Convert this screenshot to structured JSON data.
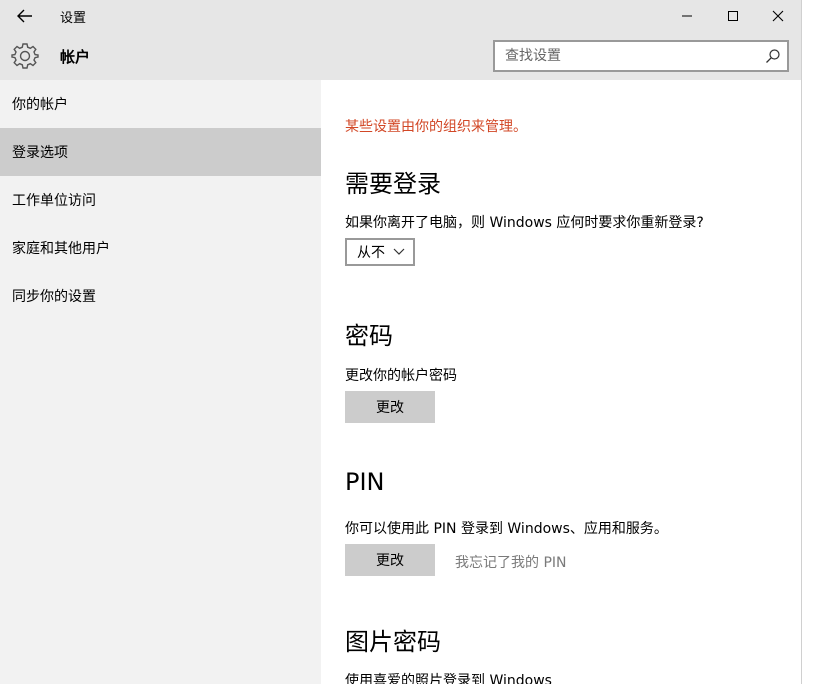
{
  "window": {
    "title": "设置",
    "back_icon": "arrow-left-icon",
    "minimize_icon": "minimize-icon",
    "maximize_icon": "maximize-icon",
    "close_icon": "close-icon"
  },
  "header": {
    "icon": "gear-icon",
    "title": "帐户",
    "search_placeholder": "查找设置",
    "search_value": "",
    "search_icon": "search-icon"
  },
  "sidebar": {
    "items": [
      {
        "label": "你的帐户",
        "selected": false
      },
      {
        "label": "登录选项",
        "selected": true
      },
      {
        "label": "工作单位访问",
        "selected": false
      },
      {
        "label": "家庭和其他用户",
        "selected": false
      },
      {
        "label": "同步你的设置",
        "selected": false
      }
    ]
  },
  "content": {
    "managed_note": "某些设置由你的组织来管理。",
    "require_signin": {
      "title": "需要登录",
      "description": "如果你离开了电脑，则 Windows 应何时要求你重新登录?",
      "dropdown_value": "从不"
    },
    "password": {
      "title": "密码",
      "description": "更改你的帐户密码",
      "button_label": "更改"
    },
    "pin": {
      "title": "PIN",
      "description": "你可以使用此 PIN 登录到 Windows、应用和服务。",
      "button_label": "更改",
      "forgot_link": "我忘记了我的 PIN"
    },
    "picture_password": {
      "title": "图片密码",
      "description": "使用喜爱的照片登录到 Windows"
    }
  },
  "colors": {
    "titlebar_bg": "#e6e6e6",
    "sidebar_bg": "#f2f2f2",
    "selected_bg": "#cccccc",
    "warning_text": "#d24726",
    "link_gray": "#7a7a7a"
  }
}
